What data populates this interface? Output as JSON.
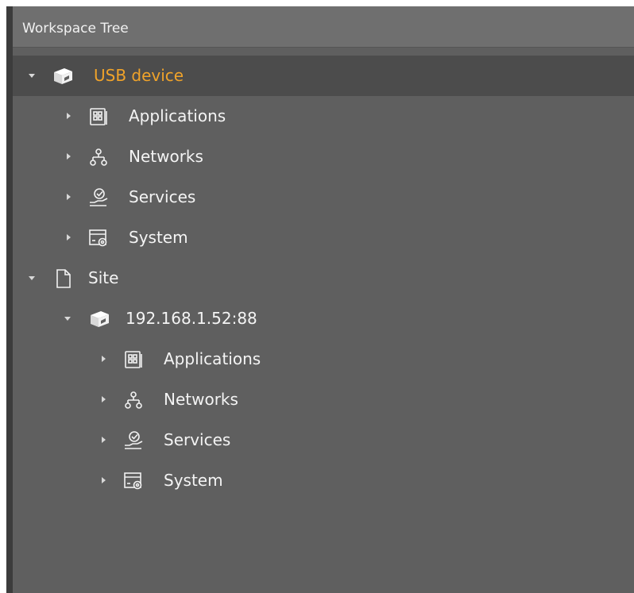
{
  "panel": {
    "title": "Workspace Tree"
  },
  "tree": {
    "usb_device": {
      "label": "USB device",
      "expanded": true,
      "selected": true,
      "icon": "device-icon",
      "children": [
        {
          "label": "Applications",
          "icon": "applications-icon",
          "expanded": false
        },
        {
          "label": "Networks",
          "icon": "networks-icon",
          "expanded": false
        },
        {
          "label": "Services",
          "icon": "services-icon",
          "expanded": false
        },
        {
          "label": "System",
          "icon": "system-icon",
          "expanded": false
        }
      ]
    },
    "site": {
      "label": "Site",
      "expanded": true,
      "icon": "document-icon",
      "device": {
        "label": "192.168.1.52:88",
        "expanded": true,
        "icon": "device-icon",
        "children": [
          {
            "label": "Applications",
            "icon": "applications-icon",
            "expanded": false
          },
          {
            "label": "Networks",
            "icon": "networks-icon",
            "expanded": false
          },
          {
            "label": "Services",
            "icon": "services-icon",
            "expanded": false
          },
          {
            "label": "System",
            "icon": "system-icon",
            "expanded": false
          }
        ]
      }
    }
  },
  "colors": {
    "panel_bg": "#5f5f5f",
    "header_bg": "#6f6f6f",
    "selected_row_bg": "#4c4c4c",
    "selected_text": "#f0a32a",
    "text": "#f4f4f4"
  }
}
